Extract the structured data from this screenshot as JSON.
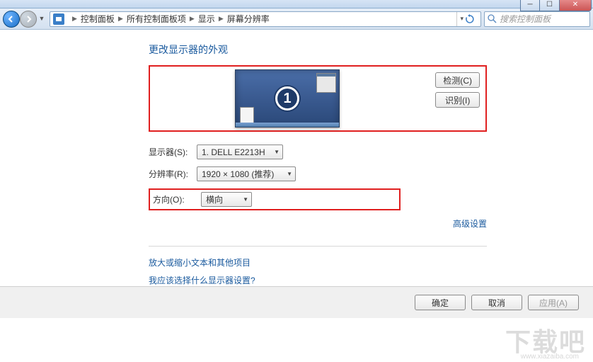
{
  "window": {
    "min_tooltip": "最小化",
    "max_tooltip": "最大化",
    "close_tooltip": "关闭"
  },
  "breadcrumb": {
    "items": [
      "控制面板",
      "所有控制面板项",
      "显示",
      "屏幕分辨率"
    ]
  },
  "search": {
    "placeholder": "搜索控制面板"
  },
  "page": {
    "title": "更改显示器的外观",
    "monitor_number": "1",
    "detect_btn": "检测(C)",
    "identify_btn": "识别(I)",
    "labels": {
      "display": "显示器(S):",
      "resolution": "分辨率(R):",
      "orientation": "方向(O):"
    },
    "values": {
      "display": "1. DELL E2213H",
      "resolution": "1920 × 1080 (推荐)",
      "orientation": "横向"
    },
    "advanced": "高级设置",
    "help1": "放大或缩小文本和其他项目",
    "help2": "我应该选择什么显示器设置?"
  },
  "commands": {
    "ok": "确定",
    "cancel": "取消",
    "apply": "应用(A)"
  },
  "watermark": {
    "text": "下载吧",
    "url": "www.xiazaiba.com"
  }
}
